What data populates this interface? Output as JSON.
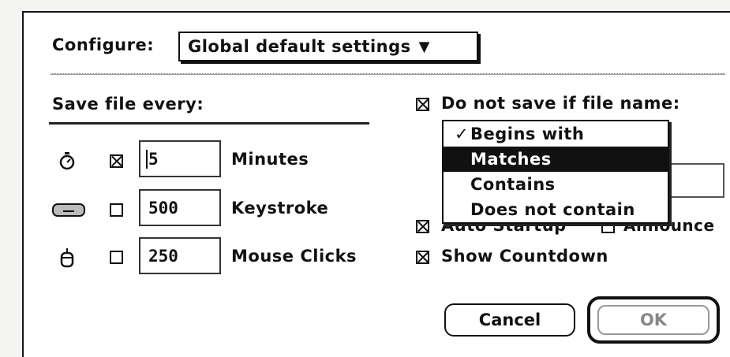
{
  "configure": {
    "label": "Configure:",
    "popup_value": "Global default settings",
    "popup_arrow": "▼"
  },
  "save_every": {
    "heading": "Save file every:",
    "rows": [
      {
        "icon": "stopwatch-icon",
        "checked": true,
        "value": "5",
        "unit": "Minutes"
      },
      {
        "icon": "keyboard-icon",
        "checked": false,
        "value": "500",
        "unit": "Keystroke"
      },
      {
        "icon": "mouse-icon",
        "checked": false,
        "value": "250",
        "unit": "Mouse Clicks"
      }
    ]
  },
  "filename_rule": {
    "label": "Do not save if file name:",
    "checked": true,
    "options": [
      "Begins with",
      "Matches",
      "Contains",
      "Does not contain"
    ],
    "checked_option": "Begins with",
    "highlighted_option": "Matches",
    "check_mark": "✓"
  },
  "options": {
    "auto_startup_label": "Auto Startup",
    "auto_startup_checked": true,
    "announce_label": "Announce",
    "announce_checked": false,
    "show_countdown_label": "Show Countdown",
    "show_countdown_checked": true
  },
  "buttons": {
    "cancel": "Cancel",
    "ok": "OK"
  }
}
